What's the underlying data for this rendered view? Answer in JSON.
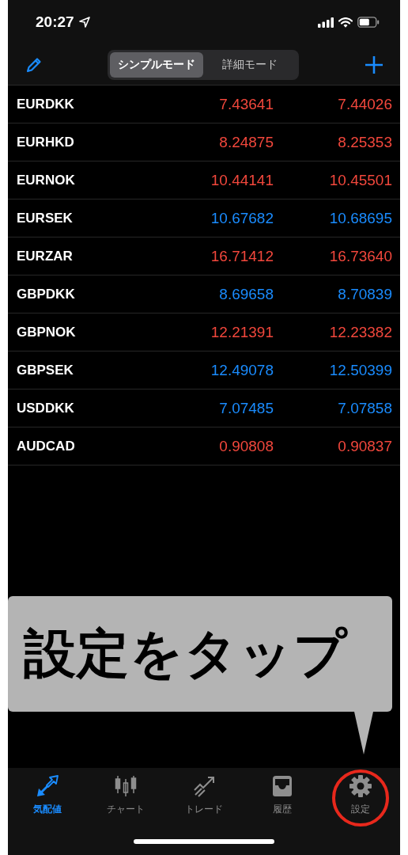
{
  "status_bar": {
    "time": "20:27"
  },
  "nav": {
    "segments": [
      {
        "label": "シンプルモード",
        "selected": true
      },
      {
        "label": "詳細モード",
        "selected": false
      }
    ]
  },
  "quotes": [
    {
      "symbol": "EURDKK",
      "bid": "7.43641",
      "ask": "7.44026",
      "color": "#f2473c"
    },
    {
      "symbol": "EURHKD",
      "bid": "8.24875",
      "ask": "8.25353",
      "color": "#f2473c"
    },
    {
      "symbol": "EURNOK",
      "bid": "10.44141",
      "ask": "10.45501",
      "color": "#f2473c"
    },
    {
      "symbol": "EURSEK",
      "bid": "10.67682",
      "ask": "10.68695",
      "color": "#1a8cff"
    },
    {
      "symbol": "EURZAR",
      "bid": "16.71412",
      "ask": "16.73640",
      "color": "#f2473c"
    },
    {
      "symbol": "GBPDKK",
      "bid": "8.69658",
      "ask": "8.70839",
      "color": "#1a8cff"
    },
    {
      "symbol": "GBPNOK",
      "bid": "12.21391",
      "ask": "12.23382",
      "color": "#f2473c"
    },
    {
      "symbol": "GBPSEK",
      "bid": "12.49078",
      "ask": "12.50399",
      "color": "#1a8cff"
    },
    {
      "symbol": "USDDKK",
      "bid": "7.07485",
      "ask": "7.07858",
      "color": "#1a8cff"
    },
    {
      "symbol": "AUDCAD",
      "bid": "0.90808",
      "ask": "0.90837",
      "color": "#f2473c"
    }
  ],
  "callout": {
    "text": "設定をタップ"
  },
  "tab_bar": [
    {
      "kind": "quotes",
      "label": "気配値",
      "selected": true,
      "highlighted": false
    },
    {
      "kind": "chart",
      "label": "チャート",
      "selected": false,
      "highlighted": false
    },
    {
      "kind": "trade",
      "label": "トレード",
      "selected": false,
      "highlighted": false
    },
    {
      "kind": "history",
      "label": "履歴",
      "selected": false,
      "highlighted": false
    },
    {
      "kind": "settings",
      "label": "設定",
      "selected": false,
      "highlighted": true
    }
  ]
}
